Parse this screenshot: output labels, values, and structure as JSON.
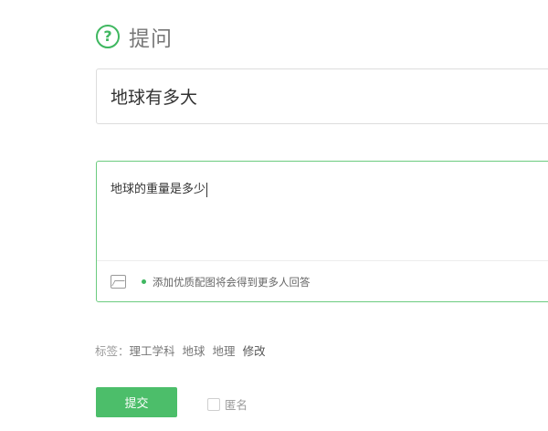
{
  "header": {
    "icon_glyph": "?",
    "title": "提问",
    "accent_color": "#3fb760"
  },
  "question": {
    "title_value": "地球有多大",
    "detail_value": "地球的重量是多少"
  },
  "toolbar": {
    "image_icon": "image-icon",
    "hint": "添加优质配图将会得到更多人回答"
  },
  "tags": {
    "label": "标签：",
    "items": [
      "理工学科",
      "地球",
      "地理"
    ],
    "edit_label": "修改"
  },
  "actions": {
    "submit_label": "提交",
    "anonymous_label": "匿名"
  }
}
